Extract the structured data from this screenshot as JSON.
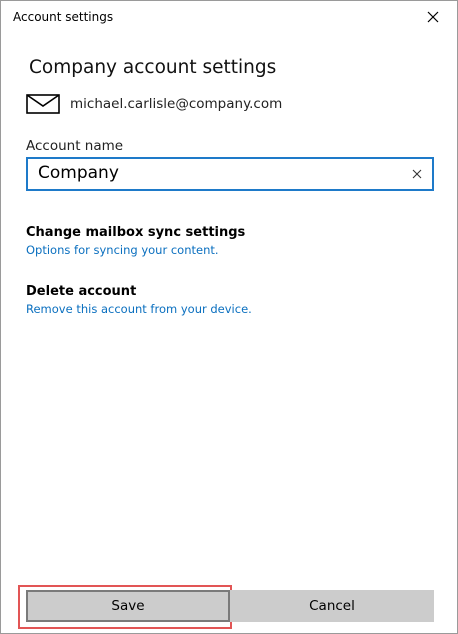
{
  "window": {
    "title": "Account settings",
    "close_icon": "close-icon"
  },
  "heading": "Company account settings",
  "account": {
    "icon": "mail-icon",
    "email": "michael.carlisle@company.com"
  },
  "account_name": {
    "label": "Account name",
    "value": "Company",
    "clear_icon": "clear-icon"
  },
  "sync_settings": {
    "title": "Change mailbox sync settings",
    "link": "Options for syncing your content."
  },
  "delete_account": {
    "title": "Delete account",
    "link": "Remove this account from your device."
  },
  "buttons": {
    "save": "Save",
    "cancel": "Cancel"
  },
  "colors": {
    "accent": "#1e7ac9",
    "link": "#0a6fbf",
    "button_bg": "#cccccc",
    "highlight": "#e25555"
  }
}
